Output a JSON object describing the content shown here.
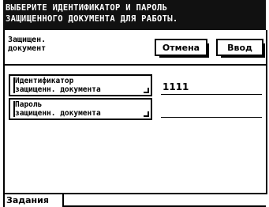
{
  "header": {
    "line1": "ВЫБЕРИТЕ ИДЕНТИФИКАТОР И ПАРОЛЬ",
    "line2": "ЗАЩИЩЕННОГО ДОКУМЕНТА ДЛЯ РАБОТЫ."
  },
  "panel": {
    "title_line1": "Защищен.",
    "title_line2": "документ",
    "cancel_label": "Отмена",
    "enter_label": "Ввод"
  },
  "fields": [
    {
      "label_line1": "Идентификатор",
      "label_line2": "защищенн. документа",
      "value": "1111"
    },
    {
      "label_line1": "Пароль",
      "label_line2": "защищенн. документа",
      "value": ""
    }
  ],
  "tabs": {
    "jobs_label": "Задания"
  }
}
